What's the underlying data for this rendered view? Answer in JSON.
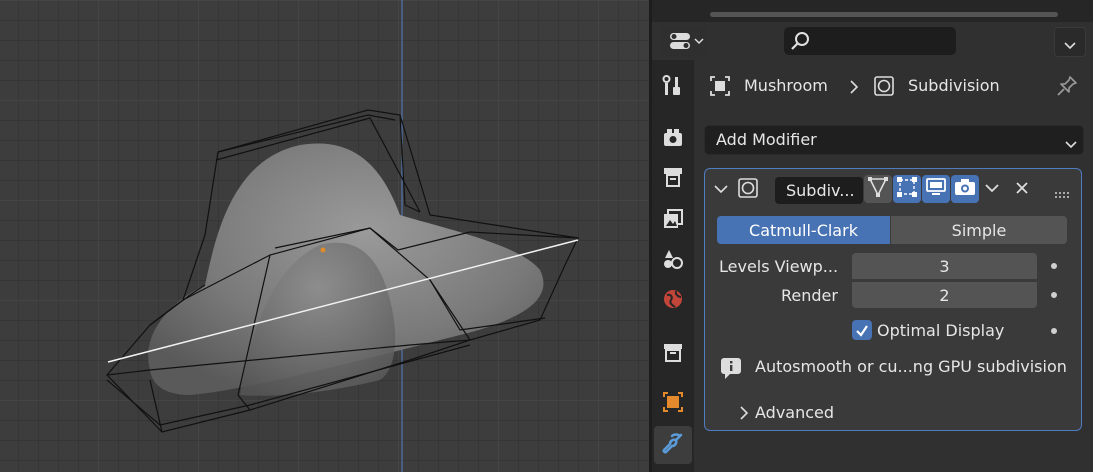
{
  "breadcrumb": {
    "object": "Mushroom",
    "modifier": "Subdivision"
  },
  "add_modifier": {
    "label": "Add Modifier"
  },
  "modifier": {
    "name": "Subdiv...",
    "modes": [
      "Catmull-Clark",
      "Simple"
    ],
    "active_mode": "Catmull-Clark",
    "levels_viewport_label": "Levels Viewp...",
    "levels_viewport": "3",
    "render_label": "Render",
    "render": "2",
    "optimal_display_label": "Optimal Display",
    "optimal_display_checked": true,
    "info": "Autosmooth or cu...ng GPU subdivision",
    "advanced_label": "Advanced"
  },
  "colors": {
    "accent": "#4772b3",
    "panel": "#303030",
    "viewport": "#3d3d3d",
    "outline": "#4f7bbf"
  },
  "properties_tabs": [
    "tool",
    "render",
    "output",
    "view-layer",
    "scene",
    "world",
    "collection",
    "object",
    "modifiers"
  ],
  "active_tab": "modifiers"
}
